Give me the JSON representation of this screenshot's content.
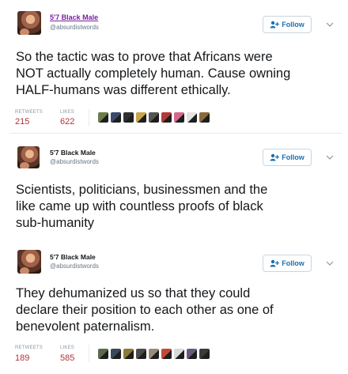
{
  "tweets": [
    {
      "author_name": "5'7 Black Male",
      "author_handle": "@absurdistwords",
      "follow_label": "Follow",
      "text_lines": [
        "So the tactic was to prove that Africans were",
        "NOT actually completely human. Cause owning",
        "HALF-humans was different ethically."
      ],
      "retweets_label": "RETWEETS",
      "retweets": "215",
      "likes_label": "LIKES",
      "likes": "622"
    },
    {
      "author_name": "5'7 Black Male",
      "author_handle": "@absurdistwords",
      "follow_label": "Follow",
      "text_lines": [
        "Scientists, politicians, businessmen and the",
        "like came up with countless proofs of black",
        "sub-humanity"
      ]
    },
    {
      "author_name": "5'7 Black Male",
      "author_handle": "@absurdistwords",
      "follow_label": "Follow",
      "text_lines": [
        "They dehumanized us so that they could",
        "declare their position to each other as one of",
        "benevolent paternalism."
      ],
      "retweets_label": "RETWEETS",
      "retweets": "189",
      "likes_label": "LIKES",
      "likes": "585"
    }
  ],
  "colors": {
    "follow_text": "#1b6fb0",
    "stat_value": "#b0353a",
    "name_link": "#7a1fa2"
  },
  "icons": [
    "avatar",
    "follow-person-icon",
    "chevron-down-icon",
    "liker-avatar"
  ]
}
